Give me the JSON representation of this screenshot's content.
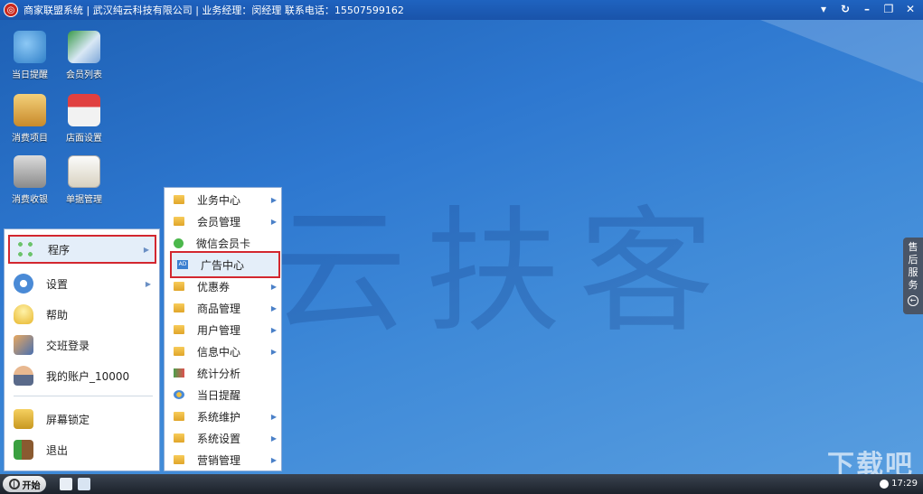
{
  "app": {
    "title": "商家联盟系统 | 武汉纯云科技有限公司 | 业务经理：闵经理 联系电话：15507599162",
    "watermark": "云扶客",
    "brand_color": "#1f63c0"
  },
  "desktop_icons": [
    {
      "label": "当日提醒",
      "icon": "reminder-icon"
    },
    {
      "label": "会员列表",
      "icon": "member-list-icon"
    },
    {
      "label": "消费项目",
      "icon": "consumption-icon"
    },
    {
      "label": "店面设置",
      "icon": "store-icon"
    },
    {
      "label": "消费收银",
      "icon": "cashier-icon"
    },
    {
      "label": "单据管理",
      "icon": "document-icon"
    }
  ],
  "start_menu": {
    "items": [
      {
        "label": "程序",
        "icon": "apps-icon",
        "has_submenu": true,
        "active": true
      },
      {
        "label": "设置",
        "icon": "gear-icon",
        "has_submenu": true
      },
      {
        "label": "帮助",
        "icon": "bulb-icon"
      },
      {
        "label": "交班登录",
        "icon": "users-icon"
      },
      {
        "label": "我的账户_10000",
        "icon": "user-icon"
      },
      {
        "label": "屏幕锁定",
        "icon": "lock-icon"
      },
      {
        "label": "退出",
        "icon": "exit-icon"
      }
    ]
  },
  "submenu": {
    "items": [
      {
        "label": "业务中心",
        "arrow": true
      },
      {
        "label": "会员管理",
        "arrow": true
      },
      {
        "label": "微信会员卡",
        "arrow": false
      },
      {
        "label": "广告中心",
        "arrow": false,
        "active": true
      },
      {
        "label": "优惠券",
        "arrow": true
      },
      {
        "label": "商品管理",
        "arrow": true
      },
      {
        "label": "用户管理",
        "arrow": true
      },
      {
        "label": "信息中心",
        "arrow": true
      },
      {
        "label": "统计分析",
        "arrow": false
      },
      {
        "label": "当日提醒",
        "arrow": false
      },
      {
        "label": "系统维护",
        "arrow": true
      },
      {
        "label": "系统设置",
        "arrow": true
      },
      {
        "label": "营销管理",
        "arrow": true
      }
    ]
  },
  "side_panel": {
    "label": "售后服务"
  },
  "taskbar": {
    "start_label": "开始",
    "clock": "17:29"
  },
  "site_watermark": "下载吧"
}
